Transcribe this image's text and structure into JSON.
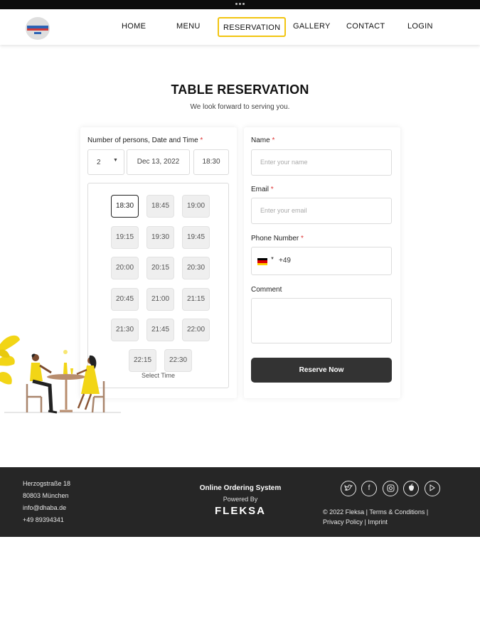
{
  "nav": {
    "items": [
      "HOME",
      "MENU",
      "RESERVATION",
      "GALLERY",
      "CONTACT",
      "LOGIN"
    ],
    "active": "RESERVATION"
  },
  "page": {
    "title": "TABLE RESERVATION",
    "subtitle": "We look forward to serving you."
  },
  "booking": {
    "label": "Number of persons, Date and Time",
    "required_mark": "*",
    "persons": "2",
    "date": "Dec 13, 2022",
    "time": "18:30",
    "slots": [
      "18:30",
      "18:45",
      "19:00",
      "19:15",
      "19:30",
      "19:45",
      "20:00",
      "20:15",
      "20:30",
      "20:45",
      "21:00",
      "21:15",
      "21:30",
      "21:45",
      "22:00",
      "22:15",
      "22:30"
    ],
    "selected_slot": "18:30",
    "select_time_label": "Select Time"
  },
  "form": {
    "name_label": "Name",
    "name_placeholder": "Enter your name",
    "email_label": "Email",
    "email_placeholder": "Enter your email",
    "phone_label": "Phone Number",
    "phone_code": "+49",
    "comment_label": "Comment",
    "submit_label": "Reserve Now"
  },
  "footer": {
    "address_lines": [
      "Herzogstraße 18",
      "80803 München",
      "info@dhaba.de",
      "+49 89394341"
    ],
    "ordering_title": "Online Ordering System",
    "powered_by": "Powered By",
    "brand": "FLEKSA",
    "copyright": "© 2022 Fleksa",
    "links": [
      "Terms & Conditions",
      "Privacy Policy",
      "Imprint"
    ],
    "social_icons": [
      "twitter-icon",
      "facebook-icon",
      "instagram-icon",
      "apple-icon",
      "google-play-icon"
    ]
  },
  "colors": {
    "accent": "#f2c511",
    "dark": "#262626",
    "button": "#333333"
  }
}
